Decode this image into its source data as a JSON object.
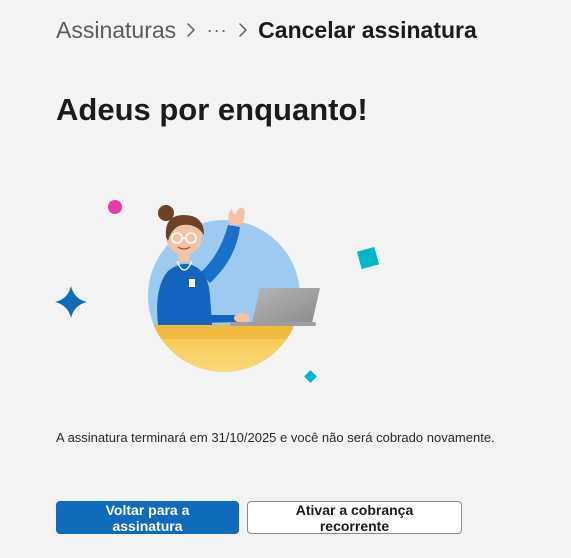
{
  "breadcrumb": {
    "root": "Assinaturas",
    "ellipsis": "···",
    "current": "Cancelar assinatura"
  },
  "page": {
    "title": "Adeus por enquanto!",
    "message": "A assinatura terminará em 31/10/2025 e você não será cobrado novamente."
  },
  "actions": {
    "primary_label": "Voltar para a assinatura",
    "secondary_label": "Ativar a cobrança recorrente"
  },
  "colors": {
    "accent": "#0f6cbd",
    "background": "#f3f3f3"
  }
}
